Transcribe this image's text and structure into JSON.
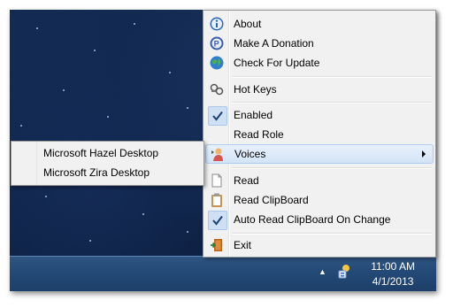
{
  "menu": {
    "items": [
      {
        "label": "About",
        "icon": "info-icon"
      },
      {
        "label": "Make A Donation",
        "icon": "paypal-icon"
      },
      {
        "label": "Check For Update",
        "icon": "globe-icon"
      },
      {
        "label": "Hot Keys",
        "icon": "keys-icon"
      },
      {
        "label": "Enabled",
        "checked": true
      },
      {
        "label": "Read Role"
      },
      {
        "label": "Voices",
        "icon": "speaker-person-icon",
        "submenu": true,
        "highlighted": true
      },
      {
        "label": "Read",
        "icon": "document-icon"
      },
      {
        "label": "Read ClipBoard",
        "icon": "clipboard-icon"
      },
      {
        "label": "Auto Read ClipBoard On Change",
        "checked": true
      },
      {
        "label": "Exit",
        "icon": "exit-door-icon"
      }
    ]
  },
  "submenu": {
    "items": [
      {
        "label": "Microsoft Hazel Desktop"
      },
      {
        "label": "Microsoft Zira Desktop"
      }
    ]
  },
  "taskbar": {
    "time": "11:00 AM",
    "date": "4/1/2013"
  },
  "colors": {
    "highlight": "#d3e4f7",
    "taskbar": "#244a77",
    "desktop": "#0d2246"
  }
}
